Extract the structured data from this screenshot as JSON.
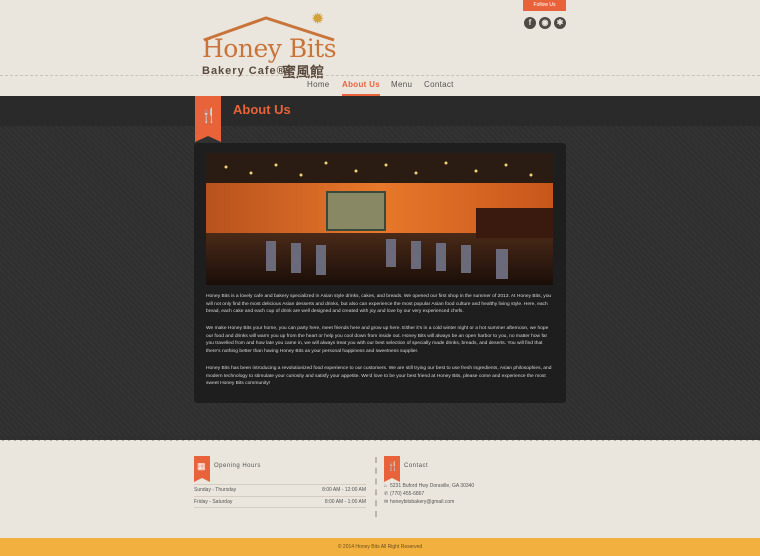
{
  "logo": {
    "name": "Honey Bits",
    "subtitle": "Bakery Cafe®",
    "chinese": "蜜風館"
  },
  "social": {
    "follow_label": "Follow Us",
    "icons": [
      "facebook-icon",
      "wechat-icon",
      "yelp-icon"
    ]
  },
  "nav": {
    "items": [
      {
        "label": "Home",
        "active": false
      },
      {
        "label": "About Us",
        "active": true
      },
      {
        "label": "Menu",
        "active": false
      },
      {
        "label": "Contact",
        "active": false
      }
    ]
  },
  "page": {
    "title": "About Us"
  },
  "content": {
    "paragraphs": [
      "Honey Bits is a lovely cafe and bakery specialized in Asian style drinks, cakes, and breads. We opened our first shop in the summer of 2013. At Honey Bits, you will not only find the most delicious Asian desserts and drinks, but also can experience the most popular Asian food culture and healthy living style. Here, each bread, each cake and each cup of drink are well designed and created with joy and love by our very experienced chefs.",
      "We make Honey Bits your home, you can party here, meet friends here and grow up here. Either it’s in a cold winter night or a hot summer afternoon, we hope our food and drinks will warm you up from the heart or help you cool down from inside out. Honey Bits will always be an open harbor to you, no matter how far you travelled from and how late you came in, we will always treat you with our best selection of specially made drinks, breads, and deserts. You will find that there’s nothing better than having Honey Bits as your personal happiness and sweetness supplier.",
      "Honey Bits has been introducing a revolutionized food experience to our customers. We are still trying our best to use fresh ingredients, Asian philosophies, and modern technology to stimulate your curiosity and satisfy your appetite. We’d love to be your best friend at Honey Bits, please come and experience the most sweet Honey Bits community!"
    ]
  },
  "footer": {
    "hours_heading": "Opening Hours",
    "hours": [
      {
        "day": "Sunday - Thursday",
        "time": "8:00 AM - 12:00 AM"
      },
      {
        "day": "Friday - Saturday",
        "time": "8:00 AM - 1:00 AM"
      }
    ],
    "contact_heading": "Contact",
    "address": "5231 Buford Hwy Doraville, GA 30340",
    "phone": "(770) 455-6867",
    "email": "honeybitsbakery@gmail.com",
    "copyright": "© 2014 Honey Bits All Right Reserved"
  },
  "colors": {
    "accent": "#e8633a",
    "background": "#ebe6dd",
    "dark": "#2f2f2f",
    "footer_bar": "#f2b13e"
  }
}
